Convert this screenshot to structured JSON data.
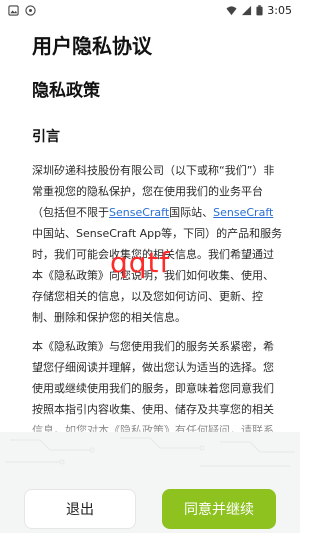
{
  "status_bar": {
    "time": "3:05",
    "icons": [
      "gallery-icon",
      "notification-icon",
      "wifi-icon",
      "signal-icon",
      "battery-icon"
    ]
  },
  "page": {
    "title": "用户隐私协议",
    "subtitle": "隐私政策",
    "section_heading": "引言",
    "para1": {
      "t1": "深圳矽递科技股份有限公司（以下或称“我们”）非常重视您的隐私保护，您在使用我们的业务平台（包括但不限于",
      "link1": "SenseCraft",
      "t2": "国际站、",
      "link2": "SenseCraft",
      "t3": "中国站、SenseCraft App等，下同）的产品和服务时，我们可能会收集您的相关信息。我们希望通过本《隐私政策》向您说明，我们如何收集、使用、存储您相关的信息，以及您如何访问、更新、控制、删除和保护您的相关信息。"
    },
    "para2": "本《隐私政策》与您使用我们的服务关系紧密，希望您仔细阅读并理解，做出您认为适当的选择。您使用或继续使用我们的服务，即意味着您同意我们按照本指引内容收集、使用、储存及共享您的相关信息。如您对本《隐私政策》有任何疑问，请联系我们。"
  },
  "watermark": "qqtf",
  "buttons": {
    "exit": "退出",
    "agree": "同意并继续"
  },
  "colors": {
    "accent": "#8dc21f",
    "link": "#2a6fd6",
    "watermark": "#ff2a2a"
  }
}
